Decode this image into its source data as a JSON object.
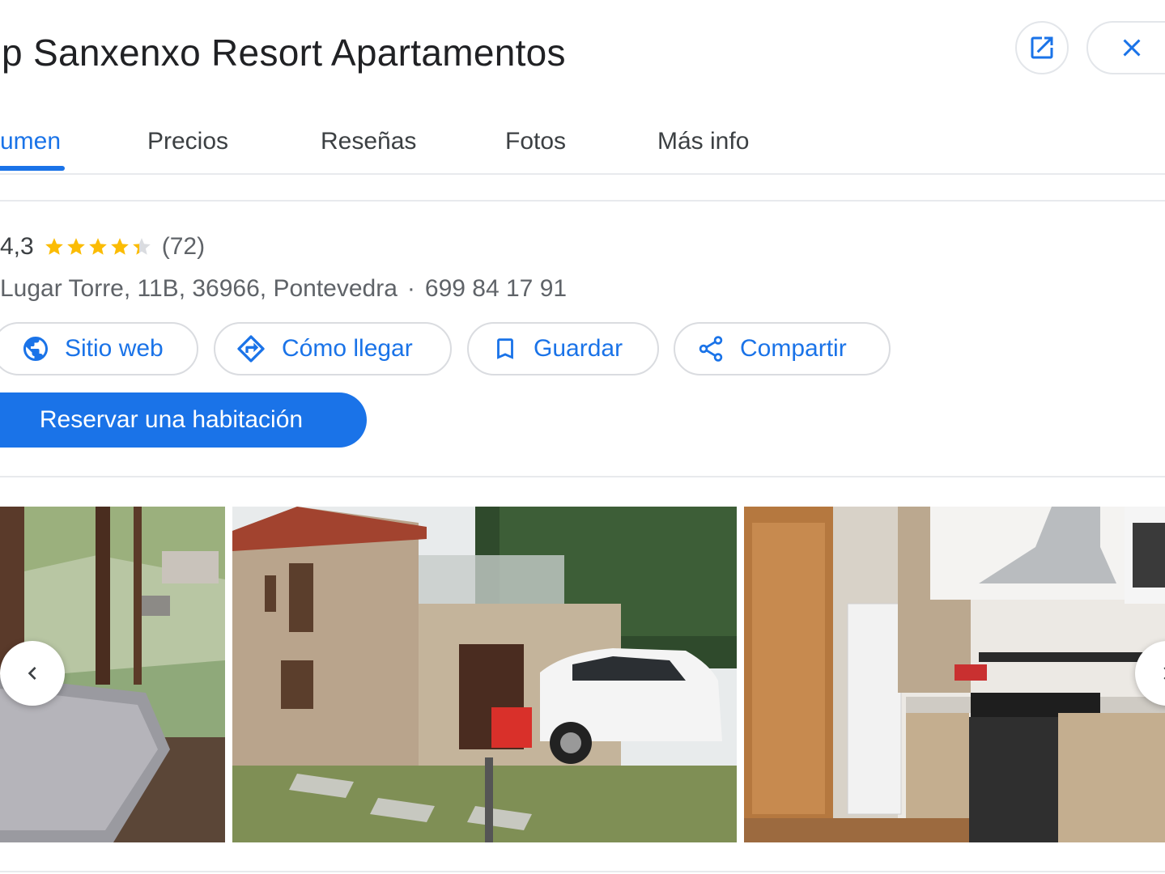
{
  "place": {
    "title": "p Sanxenxo Resort Apartamentos"
  },
  "header": {
    "open_new_icon": "open-in-new-icon",
    "close_icon": "close-icon"
  },
  "tabs": [
    {
      "label": "umen",
      "active": true
    },
    {
      "label": "Precios",
      "active": false
    },
    {
      "label": "Reseñas",
      "active": false
    },
    {
      "label": "Fotos",
      "active": false
    },
    {
      "label": "Más info",
      "active": false
    }
  ],
  "rating": {
    "value": "4,3",
    "stars": 4.3,
    "count": "(72)"
  },
  "info": {
    "address": "Lugar Torre, 11B, 36966, Pontevedra",
    "separator": "·",
    "phone": "699 84 17 91"
  },
  "actions": [
    {
      "label": "Sitio web",
      "icon": "globe-icon"
    },
    {
      "label": "Cómo llegar",
      "icon": "directions-icon"
    },
    {
      "label": "Guardar",
      "icon": "bookmark-icon"
    },
    {
      "label": "Compartir",
      "icon": "share-icon"
    }
  ],
  "primary_action": {
    "label": "Reservar una habitación"
  },
  "colors": {
    "accent": "#1a73e8",
    "star": "#fbbc04",
    "text": "#202124",
    "muted": "#5f6368"
  }
}
